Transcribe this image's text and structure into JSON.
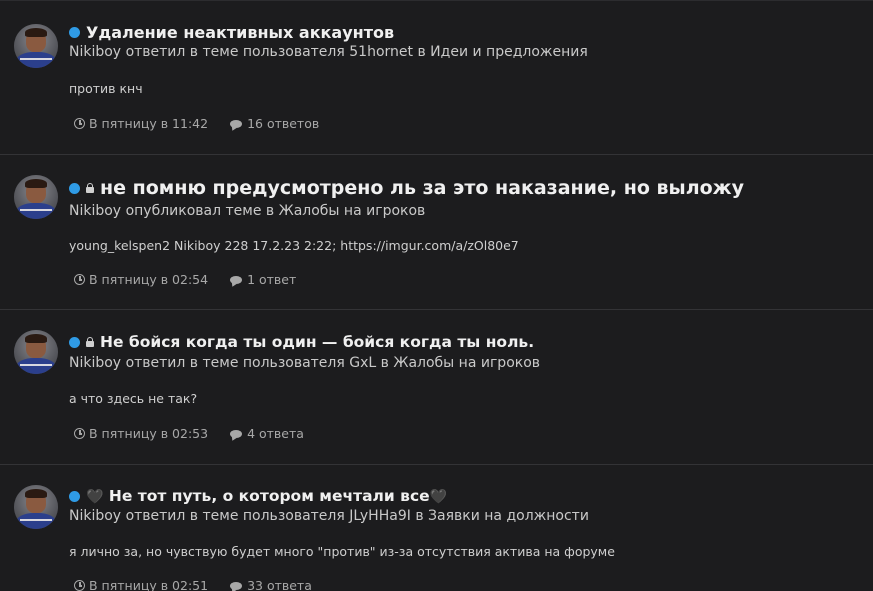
{
  "items": [
    {
      "title": "Удаление неактивных аккаунтов",
      "has_lock": false,
      "has_hearts": false,
      "byline": {
        "user": "Nikiboy",
        "action": "ответил в теме пользователя",
        "thread_author": "51hornet",
        "prep": "в",
        "forum": "Идеи и предложения"
      },
      "snippet": "против кнч",
      "date": "В пятницу в 11:42",
      "replies": "16 ответов"
    },
    {
      "title": "не помню предусмотрено ль за это наказание, но выложу",
      "has_lock": true,
      "has_hearts": false,
      "byline": {
        "user": "Nikiboy",
        "action": "опубликовал теме",
        "thread_author": "",
        "prep": "в",
        "forum": "Жалобы на игроков"
      },
      "snippet": "young_kelspen2 Nikiboy 228 17.2.23 2:22; https://imgur.com/a/zOl80e7",
      "date": "В пятницу в 02:54",
      "replies": "1 ответ"
    },
    {
      "title": "Не бойся когда ты один — бойся когда ты ноль.",
      "has_lock": true,
      "has_hearts": false,
      "byline": {
        "user": "Nikiboy",
        "action": "ответил в теме пользователя",
        "thread_author": "GxL",
        "prep": "в",
        "forum": "Жалобы на игроков"
      },
      "snippet": "а что здесь не так?",
      "date": "В пятницу в 02:53",
      "replies": "4 ответа"
    },
    {
      "title": "Не тот путь, о котором мечтали все",
      "has_lock": false,
      "has_hearts": true,
      "heart_glyph": "🖤",
      "byline": {
        "user": "Nikiboy",
        "action": "ответил в теме пользователя",
        "thread_author": "JLyHHa9I",
        "prep": "в",
        "forum": "Заявки на должности"
      },
      "snippet": "я лично за, но чувствую будет много \"против\" из-за отсутствия актива на форуме",
      "date": "В пятницу в 02:51",
      "replies": "33 ответа"
    }
  ],
  "colors": {
    "background": "#1c1c1e",
    "status_dot": "#2f9be6",
    "title": "#f0f0f0",
    "text": "#c9c9c9",
    "meta": "#a8a8a8",
    "divider": "#333336"
  },
  "icons": [
    "status-dot-icon",
    "lock-icon",
    "black-heart-icon",
    "clock-icon",
    "comment-icon"
  ]
}
